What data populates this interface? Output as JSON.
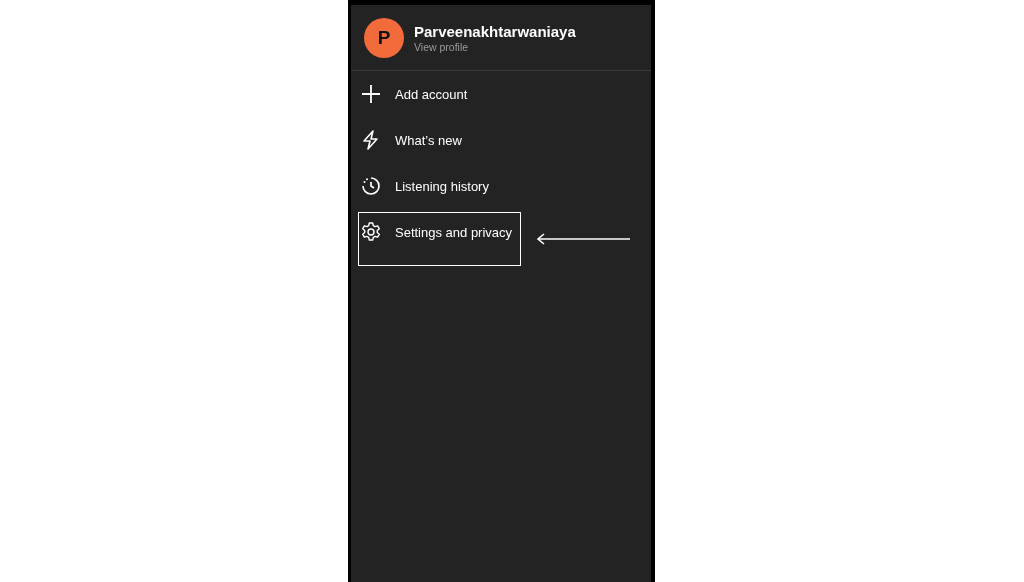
{
  "profile": {
    "initial": "P",
    "name": "Parveenakhtarwaniaya",
    "subtitle": "View profile"
  },
  "menu": [
    {
      "kind": "add",
      "label": "Add account",
      "highlighted": false
    },
    {
      "kind": "news",
      "label": "What’s new",
      "highlighted": false
    },
    {
      "kind": "history",
      "label": "Listening history",
      "highlighted": false
    },
    {
      "kind": "settings",
      "label": "Settings and privacy",
      "highlighted": true
    }
  ]
}
